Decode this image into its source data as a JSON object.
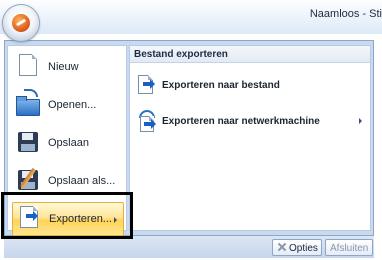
{
  "window": {
    "title": "Naamloos - Sti"
  },
  "left_menu": {
    "items": [
      {
        "label": "Nieuw",
        "icon": "new-document-icon"
      },
      {
        "label": "Openen...",
        "icon": "open-folder-icon"
      },
      {
        "label": "Opslaan",
        "icon": "save-floppy-icon"
      },
      {
        "label": "Opslaan als...",
        "icon": "save-as-icon"
      },
      {
        "label": "Exporteren...",
        "icon": "export-icon"
      }
    ]
  },
  "submenu": {
    "header": "Bestand exporteren",
    "items": [
      {
        "label": "Exporteren naar bestand",
        "icon": "export-file-icon"
      },
      {
        "label": "Exporteren naar netwerkmachine",
        "icon": "export-network-icon"
      }
    ]
  },
  "footer": {
    "options_label": "Opties",
    "exit_label": "Afsluiten"
  }
}
